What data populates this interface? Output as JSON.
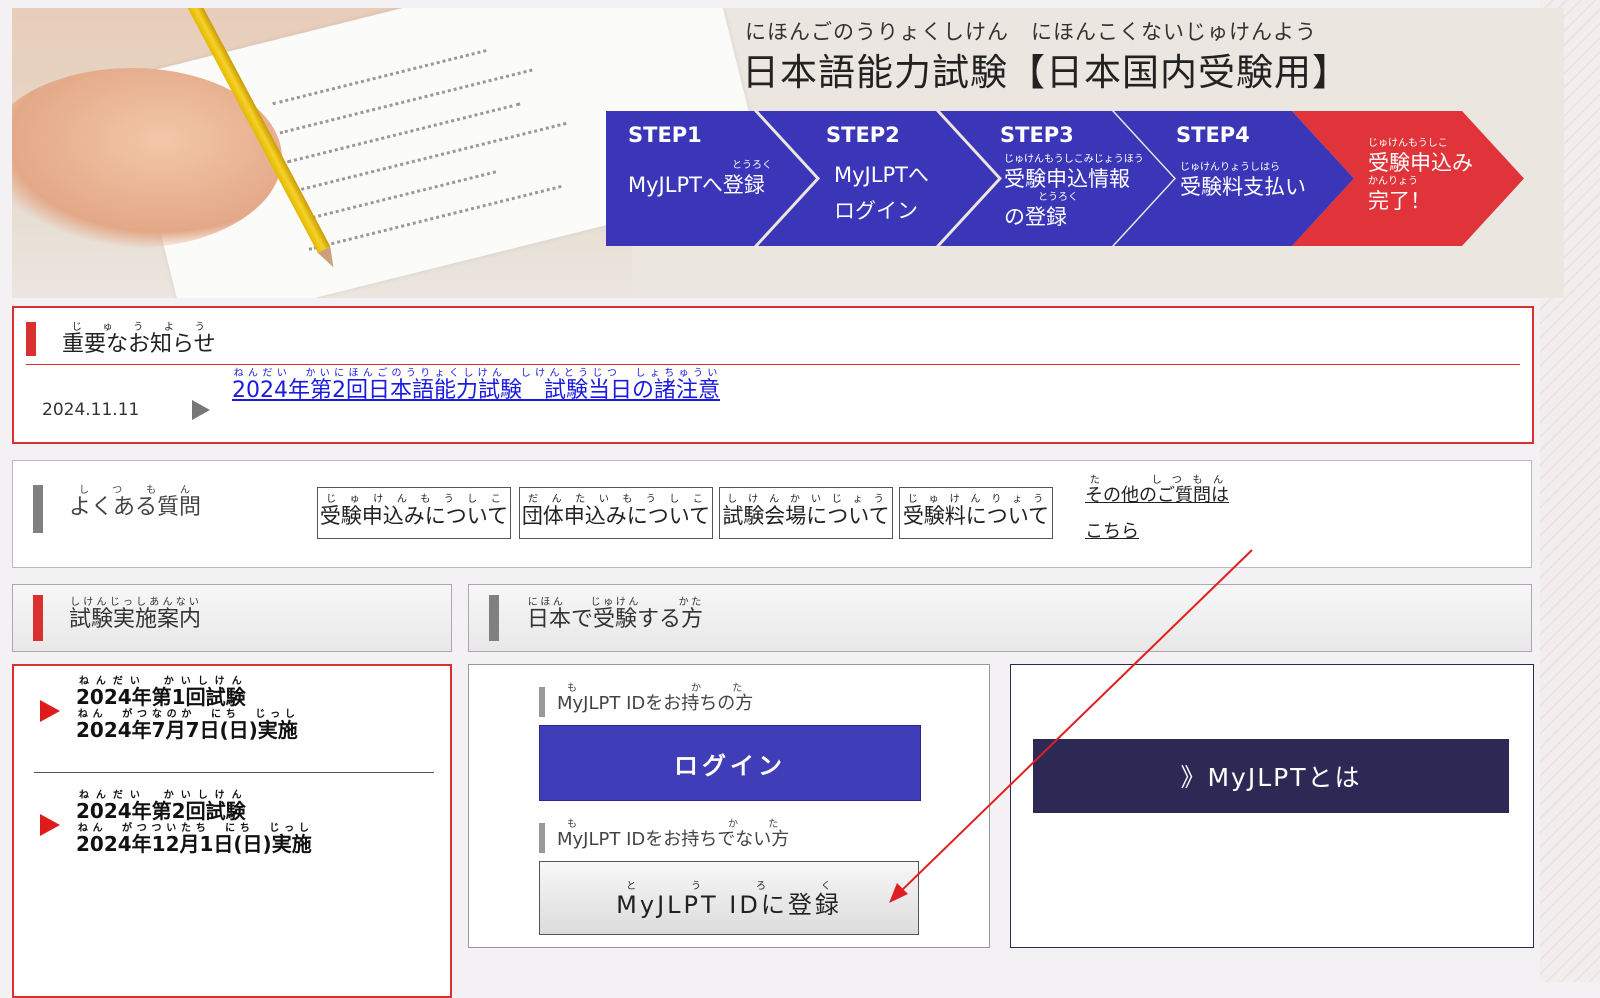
{
  "header": {
    "title_reading": "にほんごのうりょくしけん　にほんこくないじゅけんよう",
    "title": "日本語能力試験【日本国内受験用】",
    "steps": [
      {
        "no": "STEP1",
        "text1": "MyJLPTへ登録",
        "ruby": "とうろく",
        "color": "#3b36b8"
      },
      {
        "no": "STEP2",
        "text1": "MyJLPTへ",
        "text2": "ログイン",
        "color": "#3b36b8"
      },
      {
        "no": "STEP3",
        "ruby": "じゅけんもうしこみじょうほう",
        "text1": "受験申込情報",
        "ruby2": "とうろく",
        "text2": "の登録",
        "color": "#3b36b8"
      },
      {
        "no": "STEP4",
        "ruby": "じゅけんりょうしはら",
        "text1": "受験料支払い",
        "color": "#3b36b8"
      },
      {
        "ruby": "じゅけんもうしこ",
        "text1": "受験申込み",
        "ruby2": "かんりょう",
        "text2": "完了！",
        "color": "#e0333a"
      }
    ]
  },
  "notice": {
    "title": "重要なお知らせ",
    "title_ruby": [
      "じゅうよう",
      "し"
    ],
    "items": [
      {
        "date": "2024.11.11",
        "ruby": "ねんだい　かいにほんごのうりょくしけん　しけんとうじつ　しょちゅうい",
        "link": "2024年第2回日本語能力試験　試験当日の諸注意"
      }
    ]
  },
  "faq": {
    "title": "よくある質問",
    "title_ruby": "しつもん",
    "buttons": [
      {
        "ruby": "じゅけんもうしこ",
        "label": "受験申込みについて"
      },
      {
        "ruby": "だんたいもうしこ",
        "label": "団体申込みについて"
      },
      {
        "ruby": "しけんかいじょう",
        "label": "試験会場について"
      },
      {
        "ruby": "じゅけんりょう",
        "label": "受験料について"
      }
    ],
    "other_ruby": "た　　しつもん",
    "other_line1": "その他のご質問は",
    "other_line2": "こちら"
  },
  "sections": {
    "left_ruby": "しけんじっしあんない",
    "left": "試験実施案内",
    "right_ruby": "にほん　　じゅけん　　　かた",
    "right": "日本で受験する方"
  },
  "exams": [
    {
      "ruby1": "ねんだい　かいしけん",
      "line1": "2024年第1回試験",
      "ruby2": "ねん　がつなのか　にち　じっし",
      "line2": "2024年7月7日(日)実施"
    },
    {
      "ruby1": "ねんだい　かいしけん",
      "line1": "2024年第2回試験",
      "ruby2": "ねん　がつついたち　にち　じっし",
      "line2": "2024年12月1日(日)実施"
    }
  ],
  "login": {
    "have_ruby": "も　　かた",
    "have_label": "MyJLPT IDをお持ちの方",
    "login_button": "ログイン",
    "nohave_ruby": "も　　　かた",
    "nohave_label": "MyJLPT IDをお持ちでない方",
    "register_ruby": "とうろく",
    "register_button": "MyJLPT IDに登録"
  },
  "about": {
    "button": "》MyJLPTとは"
  },
  "annotation_color": "#e02020"
}
